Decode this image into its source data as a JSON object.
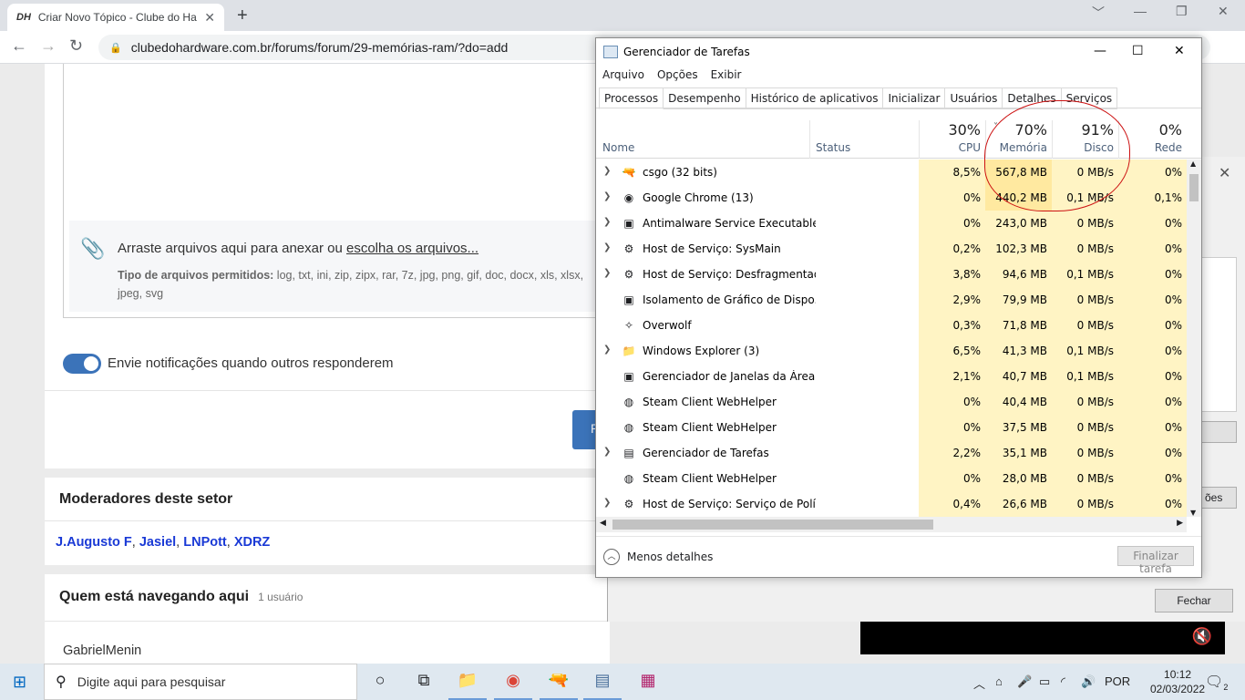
{
  "browser": {
    "tab_favicon": "DH",
    "tab_title": "Criar Novo Tópico - Clube do Ha",
    "tab_close": "✕",
    "new_tab": "+",
    "min": "﹀",
    "minimize": "—",
    "restore": "❐",
    "close": "✕",
    "back": "←",
    "forward": "→",
    "reload": "↻",
    "url": "clubedohardware.com.br/forums/forum/29-memórias-ram/?do=add"
  },
  "page": {
    "attach_prefix": "Arraste arquivos aqui para anexar ou ",
    "attach_link": "escolha os arquivos...",
    "allowed_label": "Tipo de arquivos permitidos:",
    "allowed_types": " log, txt, ini, zip, zipx, rar, 7z, jpg, png, gif, doc, docx, xls, xlsx, jpeg, svg",
    "toggle_label": "Envie notificações quando outros responderem",
    "submit_partial": "P",
    "moderators_title": "Moderadores deste setor",
    "moderators": [
      "J.Augusto F",
      "Jasiel",
      "LNPott",
      "XDRZ"
    ],
    "browsing_title": "Quem está navegando aqui",
    "browsing_count": "1 usuário",
    "browsing_user": "GabrielMenin",
    "dialog_button_partial": "ões",
    "dialog_close": "Fechar"
  },
  "taskmgr": {
    "title": "Gerenciador de Tarefas",
    "menu": [
      "Arquivo",
      "Opções",
      "Exibir"
    ],
    "tabs": [
      "Processos",
      "Desempenho",
      "Histórico de aplicativos",
      "Inicializar",
      "Usuários",
      "Detalhes",
      "Serviços"
    ],
    "col_name": "Nome",
    "col_status": "Status",
    "cpu_pct": "30%",
    "cpu_label": "CPU",
    "mem_pct": "70%",
    "mem_label": "Memória",
    "disk_pct": "91%",
    "disk_label": "Disco",
    "net_pct": "0%",
    "net_label": "Rede",
    "rows": [
      {
        "expand": true,
        "icon": "csgo-icon",
        "glyph": "🔫",
        "name": "csgo (32 bits)",
        "cpu": "8,5%",
        "mem": "567,8 MB",
        "disk": "0 MB/s",
        "net": "0%"
      },
      {
        "expand": true,
        "icon": "chrome-icon",
        "glyph": "◉",
        "name": "Google Chrome (13)",
        "cpu": "0%",
        "mem": "440,2 MB",
        "disk": "0,1 MB/s",
        "net": "0,1%"
      },
      {
        "expand": true,
        "icon": "window-icon",
        "glyph": "▣",
        "name": "Antimalware Service Executable",
        "cpu": "0%",
        "mem": "243,0 MB",
        "disk": "0 MB/s",
        "net": "0%"
      },
      {
        "expand": true,
        "icon": "gear-icon",
        "glyph": "⚙",
        "name": "Host de Serviço: SysMain",
        "cpu": "0,2%",
        "mem": "102,3 MB",
        "disk": "0 MB/s",
        "net": "0%"
      },
      {
        "expand": true,
        "icon": "gear-icon",
        "glyph": "⚙",
        "name": "Host de Serviço: Desfragmentad...",
        "cpu": "3,8%",
        "mem": "94,6 MB",
        "disk": "0,1 MB/s",
        "net": "0%"
      },
      {
        "expand": false,
        "icon": "window-icon",
        "glyph": "▣",
        "name": "Isolamento de Gráfico de Dispo...",
        "cpu": "2,9%",
        "mem": "79,9 MB",
        "disk": "0 MB/s",
        "net": "0%"
      },
      {
        "expand": false,
        "icon": "overwolf-icon",
        "glyph": "✧",
        "name": "Overwolf",
        "cpu": "0,3%",
        "mem": "71,8 MB",
        "disk": "0 MB/s",
        "net": "0%"
      },
      {
        "expand": true,
        "icon": "folder-icon",
        "glyph": "📁",
        "name": "Windows Explorer (3)",
        "cpu": "6,5%",
        "mem": "41,3 MB",
        "disk": "0,1 MB/s",
        "net": "0%"
      },
      {
        "expand": false,
        "icon": "window-icon",
        "glyph": "▣",
        "name": "Gerenciador de Janelas da Área ...",
        "cpu": "2,1%",
        "mem": "40,7 MB",
        "disk": "0,1 MB/s",
        "net": "0%"
      },
      {
        "expand": false,
        "icon": "steam-icon",
        "glyph": "◍",
        "name": "Steam Client WebHelper",
        "cpu": "0%",
        "mem": "40,4 MB",
        "disk": "0 MB/s",
        "net": "0%"
      },
      {
        "expand": false,
        "icon": "steam-icon",
        "glyph": "◍",
        "name": "Steam Client WebHelper",
        "cpu": "0%",
        "mem": "37,5 MB",
        "disk": "0 MB/s",
        "net": "0%"
      },
      {
        "expand": true,
        "icon": "taskmgr-icon",
        "glyph": "▤",
        "name": "Gerenciador de Tarefas",
        "cpu": "2,2%",
        "mem": "35,1 MB",
        "disk": "0 MB/s",
        "net": "0%"
      },
      {
        "expand": false,
        "icon": "steam-icon",
        "glyph": "◍",
        "name": "Steam Client WebHelper",
        "cpu": "0%",
        "mem": "28,0 MB",
        "disk": "0 MB/s",
        "net": "0%"
      },
      {
        "expand": true,
        "icon": "gear-icon",
        "glyph": "⚙",
        "name": "Host de Serviço: Serviço de Polít...",
        "cpu": "0,4%",
        "mem": "26,6 MB",
        "disk": "0 MB/s",
        "net": "0%"
      }
    ],
    "fewer_details": "Menos detalhes",
    "end_task": "Finalizar tarefa",
    "colors": {
      "heat_light": "#fff4c4",
      "heat_mid": "#ffe9a0",
      "heat_strong": "#ffd56a"
    }
  },
  "taskbar": {
    "search_placeholder": "Digite aqui para pesquisar",
    "lang": "POR",
    "time": "10:12",
    "date": "02/03/2022",
    "notif_count": "2"
  }
}
